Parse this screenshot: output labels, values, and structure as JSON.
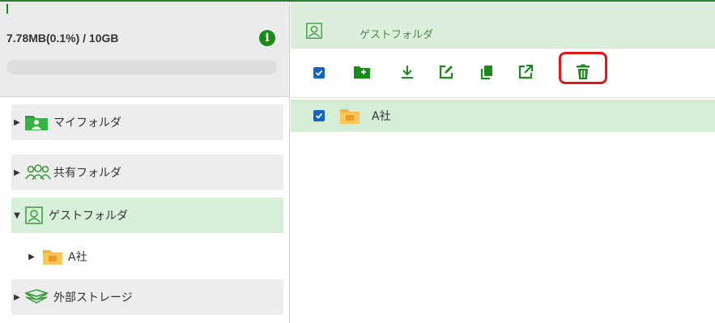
{
  "quota": {
    "text": "7.78MB(0.1%) / 10GB",
    "used_fraction": 0.001,
    "info_icon": "info-icon"
  },
  "tree": {
    "items": [
      {
        "label": "マイフォルダ",
        "icon": "my-folder-icon",
        "expanded": false
      },
      {
        "label": "共有フォルダ",
        "icon": "shared-users-icon",
        "expanded": false
      },
      {
        "label": "ゲストフォルダ",
        "icon": "guest-user-icon",
        "expanded": true,
        "selected": true
      },
      {
        "label": "A社",
        "icon": "folder-icon",
        "expanded": false,
        "child_of": "ゲストフォルダ"
      },
      {
        "label": "外部ストレージ",
        "icon": "layers-icon",
        "expanded": false
      }
    ]
  },
  "header": {
    "title": "ゲストフォルダ",
    "icon": "guest-user-icon"
  },
  "toolbar": {
    "buttons": [
      "new-folder-icon",
      "download-icon",
      "edit-icon",
      "copy-icon",
      "open-external-icon",
      "trash-icon"
    ],
    "highlighted": "trash-icon"
  },
  "files": [
    {
      "name": "A社",
      "checked": true,
      "icon": "folder-icon"
    }
  ],
  "colors": {
    "accent_green": "#1b8a1b",
    "highlight_red": "#e01818",
    "checkbox_blue": "#1565c0",
    "selected_row": "#d5ecd5"
  }
}
